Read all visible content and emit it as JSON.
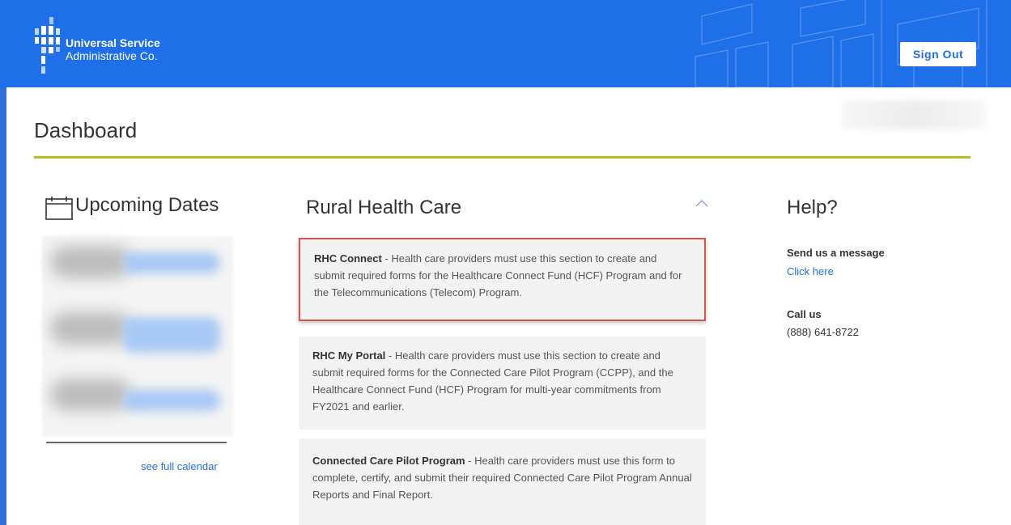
{
  "header": {
    "logo_line1": "Universal Service",
    "logo_line2": "Administrative Co.",
    "sign_out_label": "Sign Out",
    "bg_color": "#1f6fe8"
  },
  "page": {
    "title": "Dashboard",
    "accent_color": "#b5bd1f"
  },
  "upcoming": {
    "title": "Upcoming Dates",
    "icon": "calendar-icon",
    "link_label": "see full calendar"
  },
  "rhc": {
    "title": "Rural Health Care",
    "collapse_icon": "chevron-up-icon",
    "cards": [
      {
        "name": "RHC Connect",
        "sep": " - ",
        "desc": "Health care providers must use this section to create and submit required forms for the Healthcare Connect Fund (HCF) Program and for the Telecommunications (Telecom) Program."
      },
      {
        "name": "RHC My Portal",
        "sep": " - ",
        "desc": "Health care providers must use this section to create and submit required forms for the Connected Care Pilot Program (CCPP), and the Healthcare Connect Fund (HCF) Program for multi-year commitments from FY2021 and earlier."
      },
      {
        "name": "Connected Care Pilot Program",
        "sep": " - ",
        "desc": "Health care providers must use this form to complete, certify, and submit their required Connected Care Pilot Program Annual Reports and Final Report."
      }
    ]
  },
  "help": {
    "title": "Help?",
    "message_label": "Send us a message",
    "message_link": "Click here",
    "call_label": "Call us",
    "phone": "(888) 641-8722"
  }
}
